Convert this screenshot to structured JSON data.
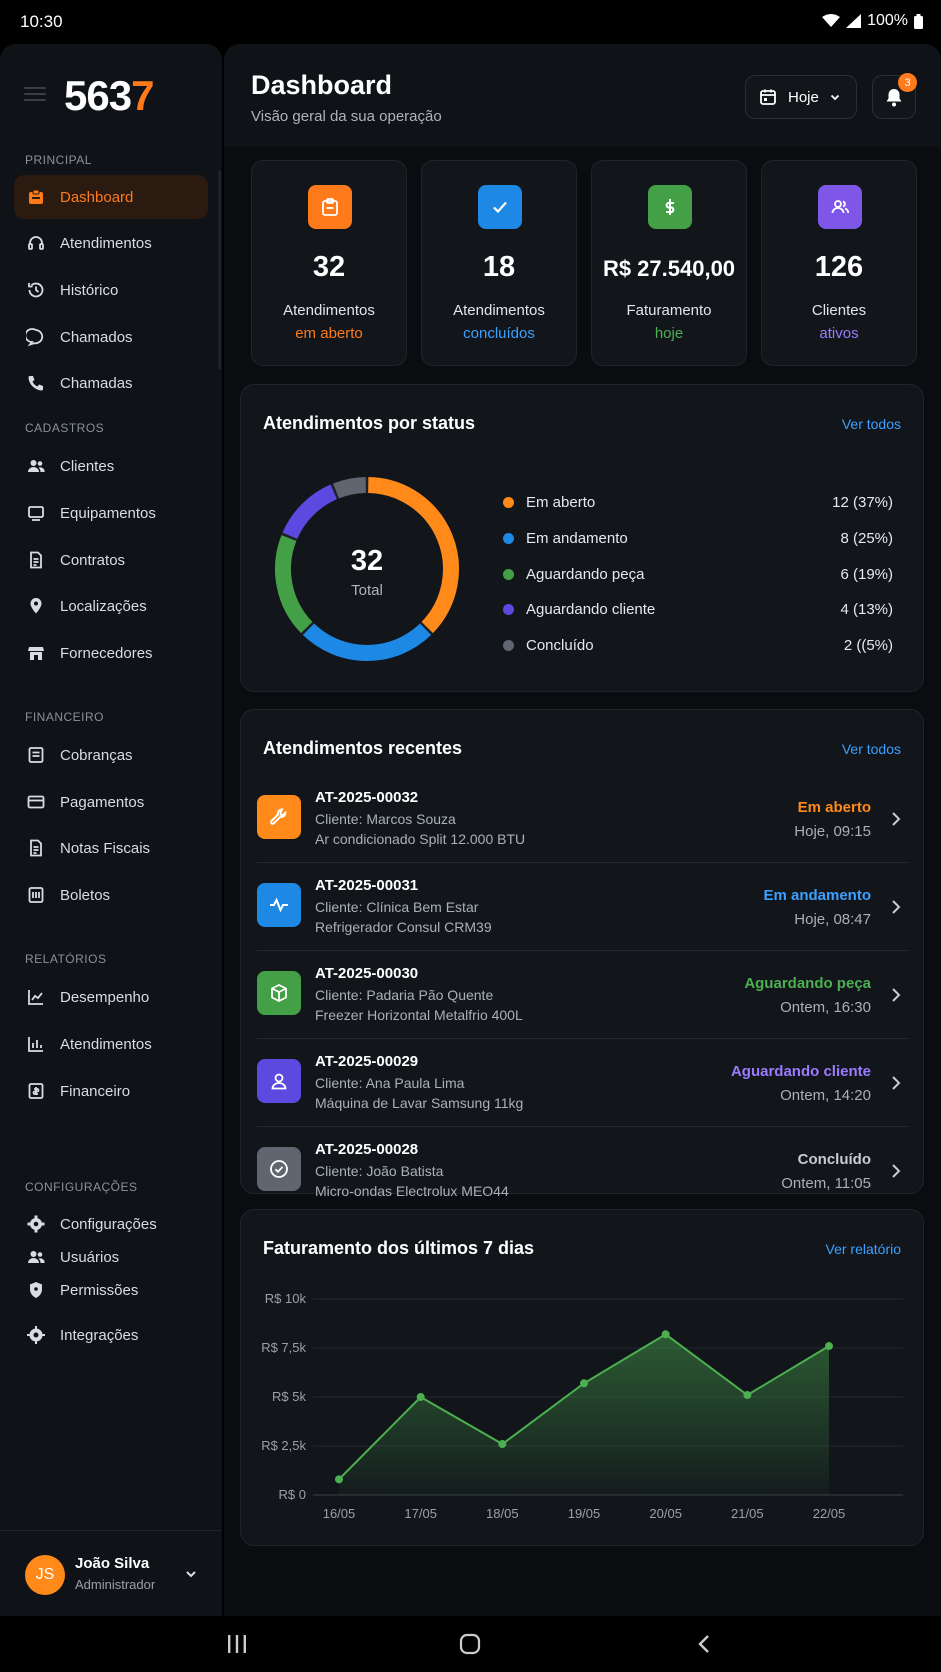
{
  "status_bar": {
    "time": "10:30",
    "battery": "100%"
  },
  "sidebar": {
    "logo_main": "563",
    "logo_accent": "7",
    "sections": {
      "principal": "PRINCIPAL",
      "cadastros": "CADASTROS",
      "financeiro": "FINANCEIRO",
      "relatorios": "RELATÓRIOS",
      "configuracoes": "CONFIGURAÇÕES"
    },
    "items": {
      "dashboard": "Dashboard",
      "atendimentos": "Atendimentos",
      "historico": "Histórico",
      "chamados": "Chamados",
      "chamadas": "Chamadas",
      "clientes": "Clientes",
      "equipamentos": "Equipamentos",
      "contratos": "Contratos",
      "localizacoes": "Localizações",
      "fornecedores": "Fornecedores",
      "cobrancas": "Cobranças",
      "pagamentos": "Pagamentos",
      "notas_fiscais": "Notas Fiscais",
      "boletos": "Boletos",
      "desempenho": "Desempenho",
      "rel_atendimentos": "Atendimentos",
      "rel_financeiro": "Financeiro",
      "configuracoes": "Configurações",
      "usuarios": "Usuários",
      "permissoes": "Permissões",
      "integracoes": "Integrações"
    },
    "user": {
      "initials": "JS",
      "name": "João Silva",
      "role": "Administrador"
    }
  },
  "header": {
    "title": "Dashboard",
    "subtitle": "Visão geral da sua operação",
    "date_filter": "Hoje",
    "notifications_count": "3"
  },
  "kpis": [
    {
      "value": "32",
      "label": "Atendimentos",
      "sub": "em aberto",
      "color": "#ff7a1a",
      "icon": "clipboard-icon"
    },
    {
      "value": "18",
      "label": "Atendimentos",
      "sub": "concluídos",
      "color": "#1e88e5",
      "icon": "check-icon"
    },
    {
      "value": "R$ 27.540,00",
      "label": "Faturamento",
      "sub": "hoje",
      "color": "#43a047",
      "icon": "dollar-icon"
    },
    {
      "value": "126",
      "label": "Clientes",
      "sub": "ativos",
      "color": "#7e57e8",
      "icon": "users-icon"
    }
  ],
  "status_card": {
    "title": "Atendimentos por status",
    "link": "Ver todos",
    "total_value": "32",
    "total_label": "Total",
    "items": [
      {
        "label": "Em aberto",
        "value": "12 (37%)",
        "count": 12,
        "color": "#ff8a1a"
      },
      {
        "label": "Em andamento",
        "value": "8 (25%)",
        "count": 8,
        "color": "#1e88e5"
      },
      {
        "label": "Aguardando peça",
        "value": "6 (19%)",
        "count": 6,
        "color": "#43a047"
      },
      {
        "label": "Aguardando cliente",
        "value": "4 (13%)",
        "count": 4,
        "color": "#5c4ae0"
      },
      {
        "label": "Concluído",
        "value": "2 ((5%)",
        "count": 2,
        "color": "#5f666f"
      }
    ]
  },
  "recent_card": {
    "title": "Atendimentos recentes",
    "link": "Ver todos",
    "rows": [
      {
        "id": "AT-2025-00032",
        "client": "Cliente: Marcos Souza",
        "equipment": "Ar condicionado Split 12.000 BTU",
        "status": "Em aberto",
        "time": "Hoje, 09:15",
        "color": "#ff8a1a",
        "icon": "wrench-icon"
      },
      {
        "id": "AT-2025-00031",
        "client": "Cliente: Clínica Bem Estar",
        "equipment": "Refrigerador Consul CRM39",
        "status": "Em andamento",
        "time": "Hoje, 08:47",
        "color": "#1e88e5",
        "icon": "pulse-icon"
      },
      {
        "id": "AT-2025-00030",
        "client": "Cliente: Padaria Pão Quente",
        "equipment": "Freezer Horizontal Metalfrio 400L",
        "status": "Aguardando peça",
        "time": "Ontem, 16:30",
        "color": "#43a047",
        "icon": "box-icon"
      },
      {
        "id": "AT-2025-00029",
        "client": "Cliente: Ana Paula Lima",
        "equipment": "Máquina de Lavar Samsung 11kg",
        "status": "Aguardando cliente",
        "time": "Ontem, 14:20",
        "color": "#5c4ae0",
        "icon": "user-icon"
      },
      {
        "id": "AT-2025-00028",
        "client": "Cliente: João Batista",
        "equipment": "Micro-ondas Electrolux MEO44",
        "status": "Concluído",
        "time": "Ontem, 11:05",
        "color": "#5f666f",
        "icon": "check-circle-icon"
      }
    ]
  },
  "revenue_card": {
    "title": "Faturamento dos últimos 7 dias",
    "link": "Ver relatório"
  },
  "chart_data": {
    "type": "area",
    "title": "Faturamento dos últimos 7 dias",
    "categories": [
      "16/05",
      "17/05",
      "18/05",
      "19/05",
      "20/05",
      "21/05",
      "22/05"
    ],
    "values": [
      800,
      5000,
      2600,
      5700,
      8200,
      5100,
      7600
    ],
    "ylim": [
      0,
      10000
    ],
    "yticks": [
      0,
      2500,
      5000,
      7500,
      10000
    ],
    "ytick_labels": [
      "R$ 0",
      "R$ 2,5k",
      "R$ 5k",
      "R$ 7,5k",
      "R$ 10k"
    ],
    "grid": true,
    "color": "#4caf50"
  }
}
